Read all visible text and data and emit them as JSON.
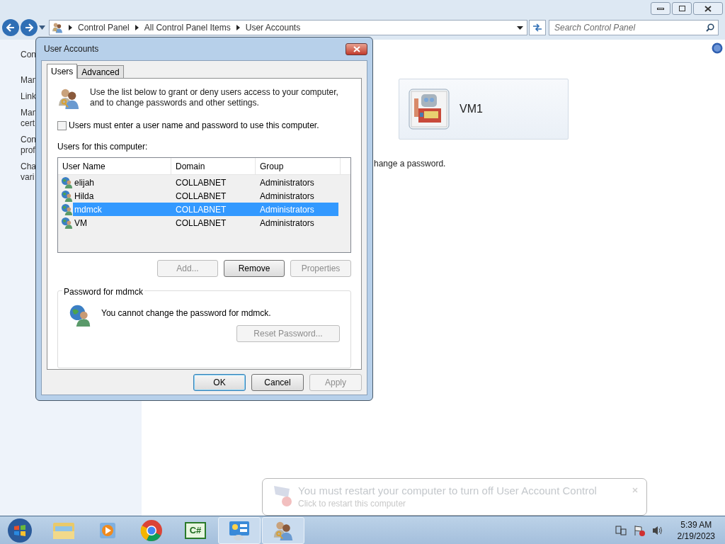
{
  "explorer": {
    "breadcrumb": [
      "Control Panel",
      "All Control Panel Items",
      "User Accounts"
    ],
    "search": {
      "placeholder": "Search Control Panel"
    },
    "sidebar_items": [
      "Con",
      "Man",
      "Link",
      "Man\ncert",
      "Con\nprof",
      "Cha\nvari"
    ],
    "account": {
      "name": "VM1"
    },
    "link": "hange a password."
  },
  "dialog": {
    "title": "User Accounts",
    "tabs": [
      {
        "label": "Users",
        "selected": true
      },
      {
        "label": "Advanced",
        "selected": false
      }
    ],
    "intro": "Use the list below to grant or deny users access to your computer, and to change passwords and other settings.",
    "checkbox": {
      "label": "Users must enter a user name and password to use this computer.",
      "checked": false
    },
    "list_label": "Users for this computer:",
    "table": {
      "columns": [
        "User Name",
        "Domain",
        "Group"
      ],
      "rows": [
        {
          "cells": [
            "elijah",
            "COLLABNET",
            "Administrators"
          ],
          "selected": false
        },
        {
          "cells": [
            "Hilda",
            "COLLABNET",
            "Administrators"
          ],
          "selected": false
        },
        {
          "cells": [
            "mdmck",
            "COLLABNET",
            "Administrators"
          ],
          "selected": true
        },
        {
          "cells": [
            "VM",
            "COLLABNET",
            "Administrators"
          ],
          "selected": false
        }
      ]
    },
    "buttons": [
      {
        "label": "Add...",
        "disabled": true
      },
      {
        "label": "Remove",
        "disabled": false
      },
      {
        "label": "Properties",
        "disabled": true
      }
    ],
    "password_group": {
      "title": "Password for mdmck",
      "message": "You cannot change the password for mdmck.",
      "button": {
        "label": "Reset Password...",
        "disabled": true
      }
    },
    "footer_buttons": [
      {
        "label": "OK",
        "disabled": false,
        "default": true
      },
      {
        "label": "Cancel",
        "disabled": false,
        "default": false
      },
      {
        "label": "Apply",
        "disabled": true,
        "default": false
      }
    ]
  },
  "notification": {
    "title": "You must restart your computer to turn off User Account Control",
    "subtitle": "Click to restart this computer"
  },
  "taskbar": {
    "apps": [
      {
        "kind": "explorer",
        "active": false
      },
      {
        "kind": "media",
        "active": false
      },
      {
        "kind": "chrome",
        "active": false
      },
      {
        "kind": "csharp",
        "label": "C#",
        "active": false
      },
      {
        "kind": "control-panel",
        "active": true
      },
      {
        "kind": "users",
        "active": true
      }
    ],
    "clock": {
      "time": "5:39 AM",
      "date": "2/19/2023"
    }
  }
}
